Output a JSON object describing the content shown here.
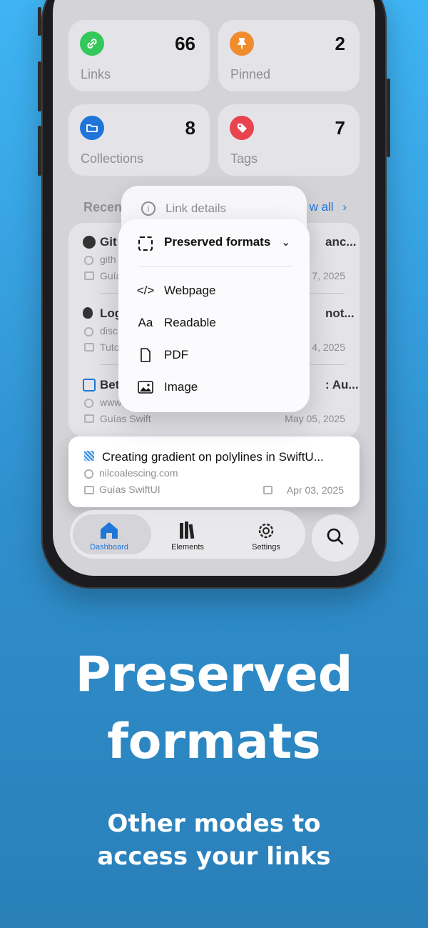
{
  "stats": [
    {
      "label": "Links",
      "count": "66",
      "color": "#34c759",
      "icon": "link-icon"
    },
    {
      "label": "Pinned",
      "count": "2",
      "color": "#f08c2e",
      "icon": "pin-icon"
    },
    {
      "label": "Collections",
      "count": "8",
      "color": "#1f76d8",
      "icon": "folder-icon"
    },
    {
      "label": "Tags",
      "count": "7",
      "color": "#e8434f",
      "icon": "tag-icon"
    }
  ],
  "recent": {
    "title": "Recen",
    "view_all": "w all"
  },
  "background_rows": [
    {
      "title": "Git",
      "title_tail": "anc...",
      "url": "gith",
      "folder": "Guía",
      "date": "7, 2025"
    },
    {
      "title": "Log",
      "title_tail": "not...",
      "url": "disc",
      "folder": "Tuto",
      "date": "4, 2025"
    },
    {
      "title": "Bet",
      "title_tail": ": Au...",
      "url": "www",
      "folder": "Guías Swift",
      "date": "May 05, 2025"
    }
  ],
  "highlighted_row": {
    "title": "Creating gradient on polylines in SwiftU...",
    "url": "nilcoalescing.com",
    "folder": "Guías SwiftUI",
    "date": "Apr 03, 2025"
  },
  "menu_back": {
    "label": "Link details",
    "icon": "info-icon"
  },
  "menu": {
    "header": "Preserved formats",
    "items": [
      {
        "label": "Webpage",
        "icon": "code-icon"
      },
      {
        "label": "Readable",
        "icon": "text-icon"
      },
      {
        "label": "PDF",
        "icon": "document-icon"
      },
      {
        "label": "Image",
        "icon": "photo-icon"
      }
    ]
  },
  "tabbar": {
    "items": [
      {
        "label": "Dashboard",
        "icon": "house-icon",
        "active": true
      },
      {
        "label": "Elements",
        "icon": "books-icon",
        "active": false
      },
      {
        "label": "Settings",
        "icon": "gear-icon",
        "active": false
      }
    ],
    "search_icon": "search-icon"
  },
  "headline": {
    "line1": "Preserved",
    "line2": "formats"
  },
  "subheadline": {
    "line1": "Other modes to",
    "line2": "access your links"
  },
  "colors": {
    "accent": "#1f76d8",
    "background_top": "#3fb4f4",
    "background_bottom": "#2a7fb8"
  }
}
